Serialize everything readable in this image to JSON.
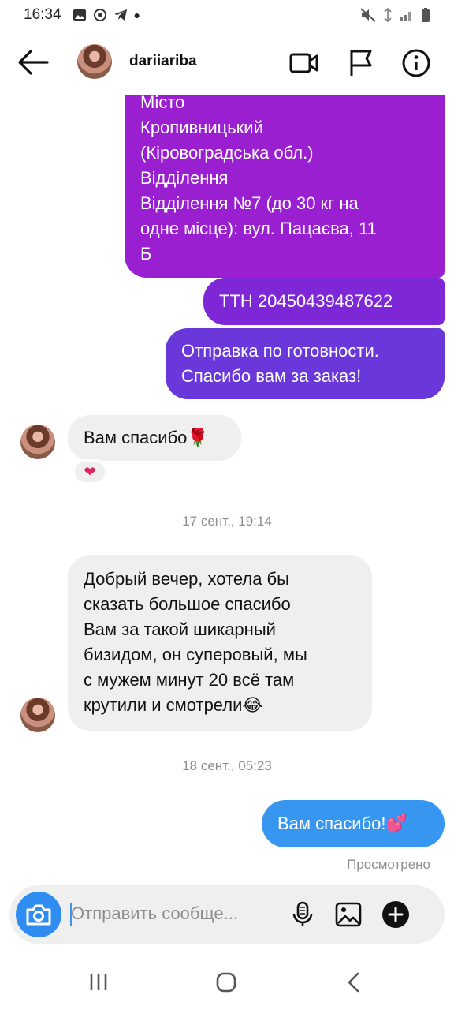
{
  "status": {
    "time": "16:34"
  },
  "header": {
    "username": "dariiariba"
  },
  "messages": {
    "m1": [
      "Місто",
      "Кропивницький",
      "(Кіровоградська обл.)",
      "Відділення",
      "Відділення №7 (до 30 кг на",
      "одне місце): вул. Пацаєва, 11",
      "Б"
    ],
    "m2": "ТТН 20450439487622",
    "m3": [
      "Отправка по готовности.",
      "Спасибо вам за заказ!"
    ],
    "m4": "Вам спасибо🌹",
    "m4_reaction": "❤",
    "ts1": "17 сент., 19:14",
    "m5": [
      "Добрый вечер, хотела бы",
      "сказать большое спасибо",
      "Вам за такой шикарный",
      "бизидом, он суперовый, мы",
      "с мужем минут 20 всё там",
      "крутили и смотрели😂"
    ],
    "ts2": "18 сент., 05:23",
    "m6": "Вам спасибо!💕",
    "seen": "Просмотрено"
  },
  "composer": {
    "placeholder": "Отправить сообще..."
  },
  "colors": {
    "accent": "#3797f0",
    "purple": "#9a1fd0",
    "bubble_in": "#efefef"
  },
  "icons": [
    "back-arrow-icon",
    "video-call-icon",
    "flag-icon",
    "info-icon",
    "camera-icon",
    "microphone-icon",
    "gallery-icon",
    "plus-icon",
    "recent-apps-icon",
    "home-icon",
    "back-nav-icon"
  ]
}
